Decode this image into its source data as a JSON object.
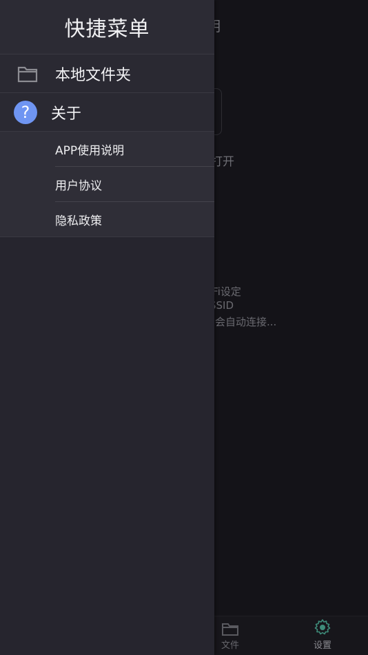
{
  "background": {
    "title_fragment": "明",
    "open_fragment": "打开",
    "lines": [
      "iFi设定",
      "SSID",
      "会自动连接..."
    ],
    "tabs": [
      {
        "label": "文件",
        "icon": "folder-icon"
      },
      {
        "label": "设置",
        "icon": "gear-icon"
      }
    ]
  },
  "drawer": {
    "title": "快捷菜单",
    "items": [
      {
        "label": "本地文件夹",
        "icon": "folder-icon"
      },
      {
        "label": "关于",
        "icon": "help-icon",
        "glyph": "?"
      }
    ],
    "about_submenu": [
      "APP使用说明",
      "用户协议",
      "隐私政策"
    ]
  },
  "colors": {
    "drawer_bg": "#26252e",
    "header_bg": "#2c2b34",
    "help_icon": "#6f95f2",
    "backdrop": "#121116"
  }
}
